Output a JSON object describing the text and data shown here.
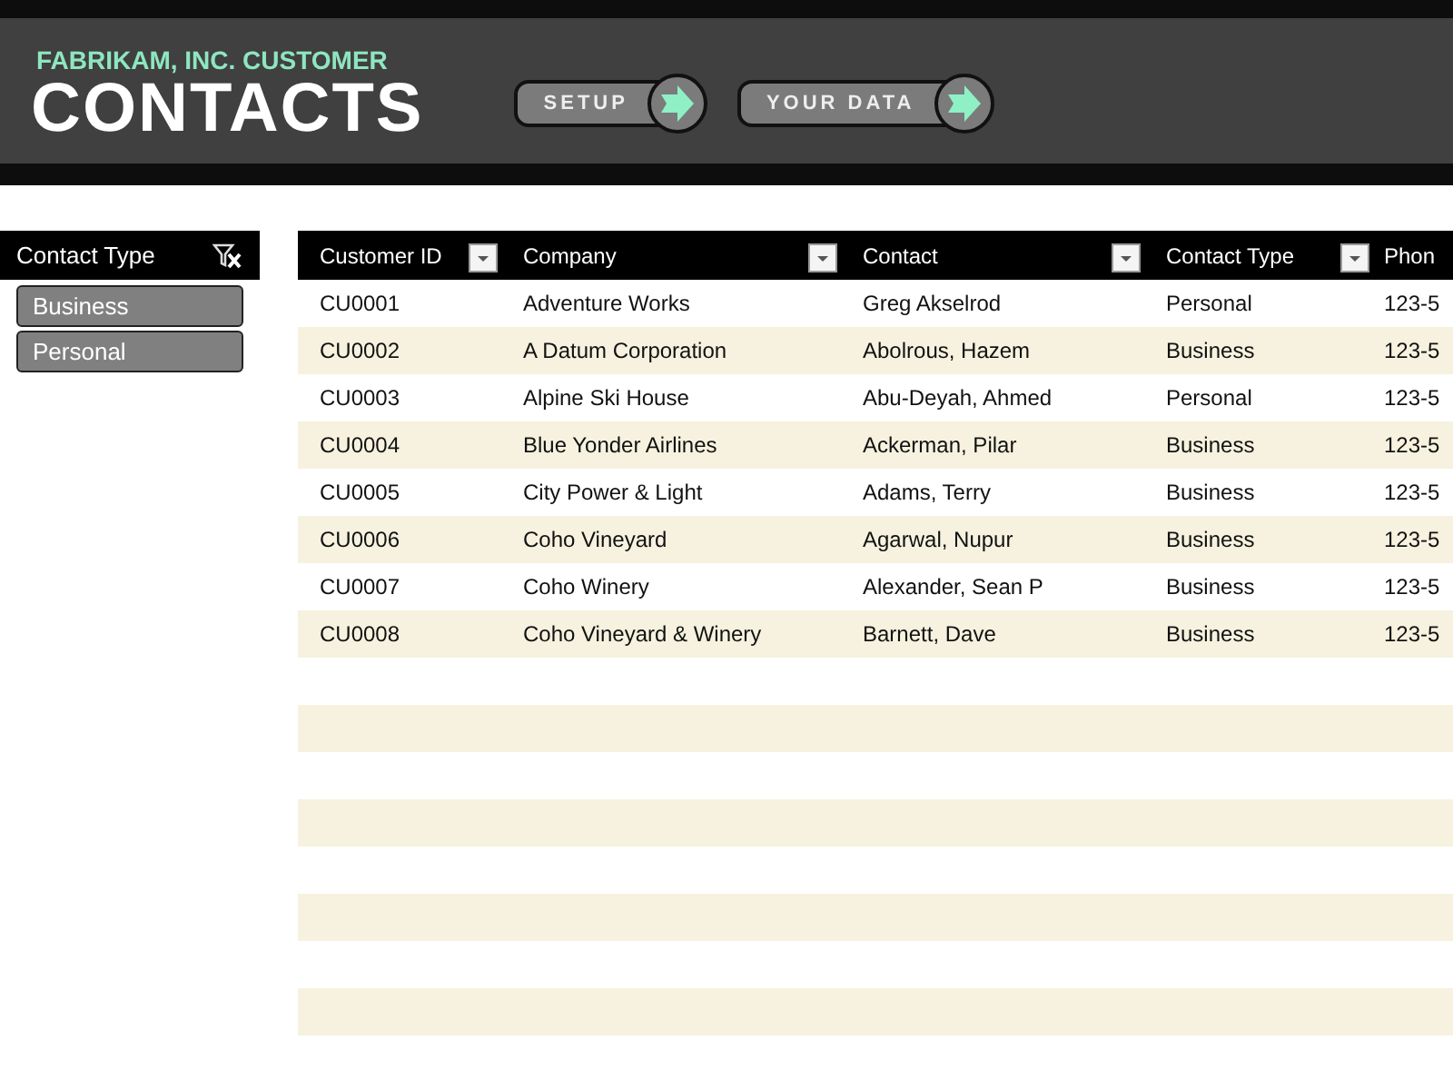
{
  "header": {
    "subtitle": "FABRIKAM, INC. CUSTOMER",
    "title": "CONTACTS",
    "buttons": [
      "SETUP",
      "YOUR DATA"
    ]
  },
  "slicer": {
    "title": "Contact Type",
    "items": [
      {
        "label": "Business",
        "selected": true
      },
      {
        "label": "Personal",
        "selected": true
      }
    ]
  },
  "table": {
    "columns": [
      "Customer ID",
      "Company",
      "Contact",
      "Contact Type",
      "Phon"
    ],
    "rows": [
      [
        "CU0001",
        "Adventure Works",
        "Greg Akselrod",
        "Personal",
        "123-5"
      ],
      [
        "CU0002",
        "A Datum Corporation",
        "Abolrous, Hazem",
        "Business",
        "123-5"
      ],
      [
        "CU0003",
        "Alpine Ski House",
        "Abu-Deyah, Ahmed",
        "Personal",
        "123-5"
      ],
      [
        "CU0004",
        "Blue Yonder Airlines",
        "Ackerman, Pilar",
        "Business",
        "123-5"
      ],
      [
        "CU0005",
        "City Power & Light",
        "Adams, Terry",
        "Business",
        "123-5"
      ],
      [
        "CU0006",
        "Coho Vineyard",
        "Agarwal, Nupur",
        "Business",
        "123-5"
      ],
      [
        "CU0007",
        "Coho Winery",
        "Alexander, Sean P",
        "Business",
        "123-5"
      ],
      [
        "CU0008",
        "Coho Vineyard & Winery",
        "Barnett, Dave",
        "Business",
        "123-5"
      ]
    ]
  }
}
